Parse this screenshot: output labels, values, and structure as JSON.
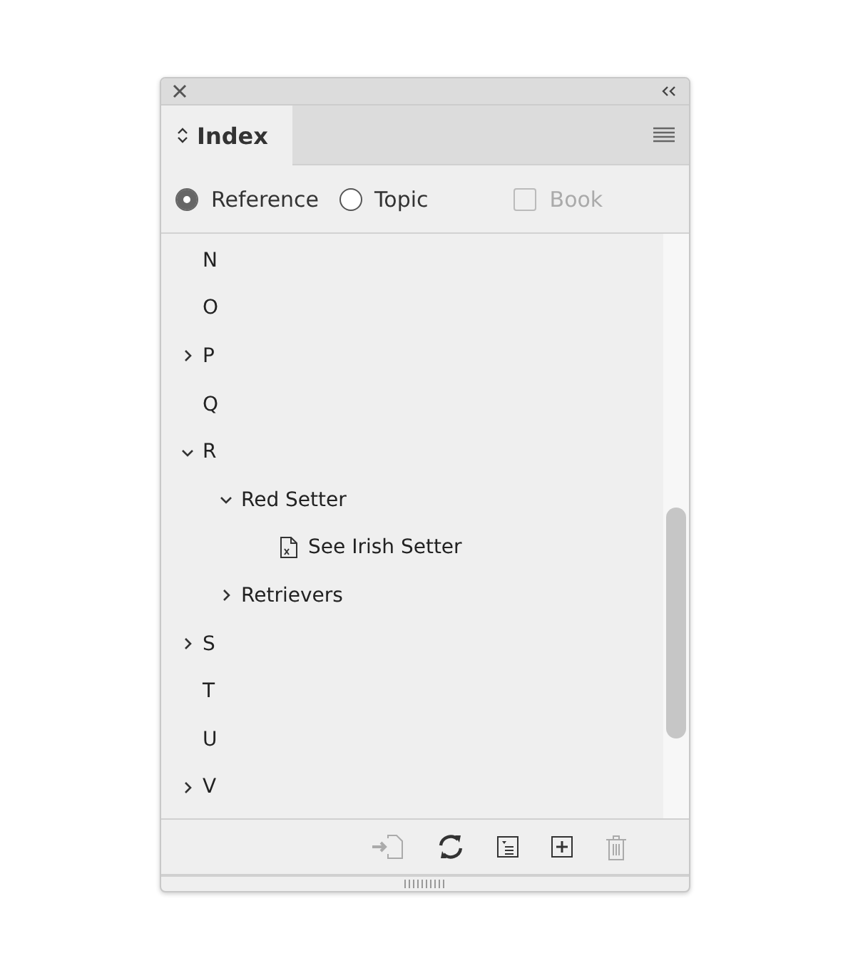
{
  "panel": {
    "tab": "Index"
  },
  "options": [
    {
      "kind": "radio",
      "label": "Reference",
      "selected": true
    },
    {
      "kind": "radio",
      "label": "Topic",
      "selected": false
    },
    {
      "kind": "checkbox",
      "label": "Book",
      "selected": false,
      "disabled": true
    }
  ],
  "tree": [
    {
      "label": "N",
      "kind": "leaf"
    },
    {
      "label": "O",
      "kind": "leaf"
    },
    {
      "label": "P",
      "kind": "branch",
      "expanded": false
    },
    {
      "label": "Q",
      "kind": "leaf"
    },
    {
      "label": "R",
      "kind": "branch",
      "expanded": true,
      "children": [
        {
          "label": "Red Setter",
          "kind": "branch",
          "expanded": true,
          "children": [
            {
              "label": "See Irish Setter",
              "kind": "reference"
            }
          ]
        },
        {
          "label": "Retrievers",
          "kind": "branch",
          "expanded": false
        }
      ]
    },
    {
      "label": "S",
      "kind": "branch",
      "expanded": false
    },
    {
      "label": "T",
      "kind": "leaf"
    },
    {
      "label": "U",
      "kind": "leaf"
    },
    {
      "label": "V",
      "kind": "branch",
      "expanded": false
    }
  ],
  "footer_buttons": [
    {
      "kind": "goto",
      "disabled": true
    },
    {
      "kind": "update",
      "disabled": false
    },
    {
      "kind": "pages",
      "disabled": false
    },
    {
      "kind": "new",
      "disabled": false
    },
    {
      "kind": "delete",
      "disabled": true
    }
  ]
}
